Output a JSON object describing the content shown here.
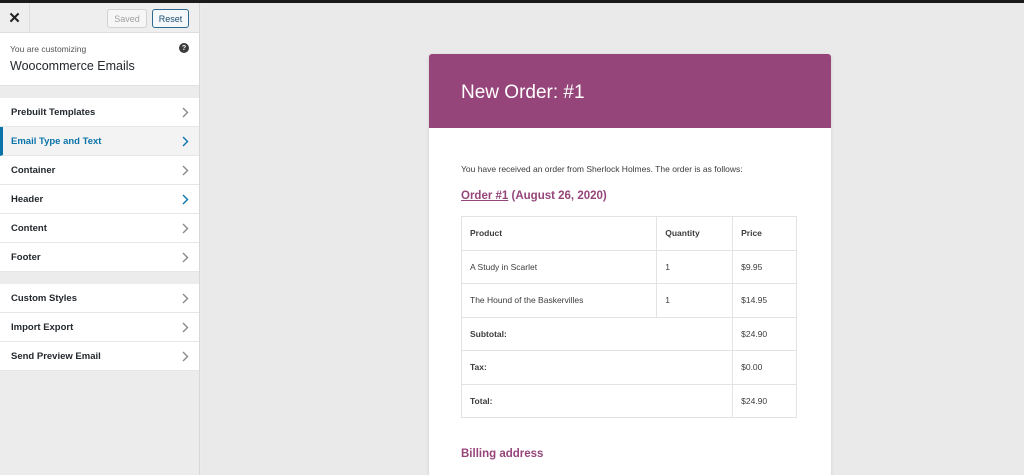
{
  "sidebar": {
    "close_icon": "close-icon",
    "saved_label": "Saved",
    "reset_label": "Reset",
    "customizing_label": "You are customizing",
    "customizing_title": "Woocommerce Emails",
    "help_icon": "question-circle-icon",
    "group1": [
      {
        "label": "Prebuilt Templates",
        "active": false
      },
      {
        "label": "Email Type and Text",
        "active": true
      },
      {
        "label": "Container",
        "active": false
      },
      {
        "label": "Header",
        "active": false
      },
      {
        "label": "Content",
        "active": false
      },
      {
        "label": "Footer",
        "active": false
      }
    ],
    "group2": [
      {
        "label": "Custom Styles"
      },
      {
        "label": "Import Export"
      },
      {
        "label": "Send Preview Email"
      }
    ],
    "accent_color": "#0a73aa"
  },
  "email": {
    "header_color": "#96457a",
    "heading": "New Order: #1",
    "intro": "You have received an order from Sherlock Holmes. The order is as follows:",
    "order_link": "Order #1",
    "order_date": " (August 26, 2020)",
    "table": {
      "headers": [
        "Product",
        "Quantity",
        "Price"
      ],
      "rows": [
        [
          "A Study in Scarlet",
          "1",
          "$9.95"
        ],
        [
          "The Hound of the Baskervilles",
          "1",
          "$14.95"
        ]
      ],
      "totals": [
        [
          "Subtotal:",
          "$24.90"
        ],
        [
          "Tax:",
          "$0.00"
        ],
        [
          "Total:",
          "$24.90"
        ]
      ]
    },
    "billing_heading": "Billing address"
  }
}
